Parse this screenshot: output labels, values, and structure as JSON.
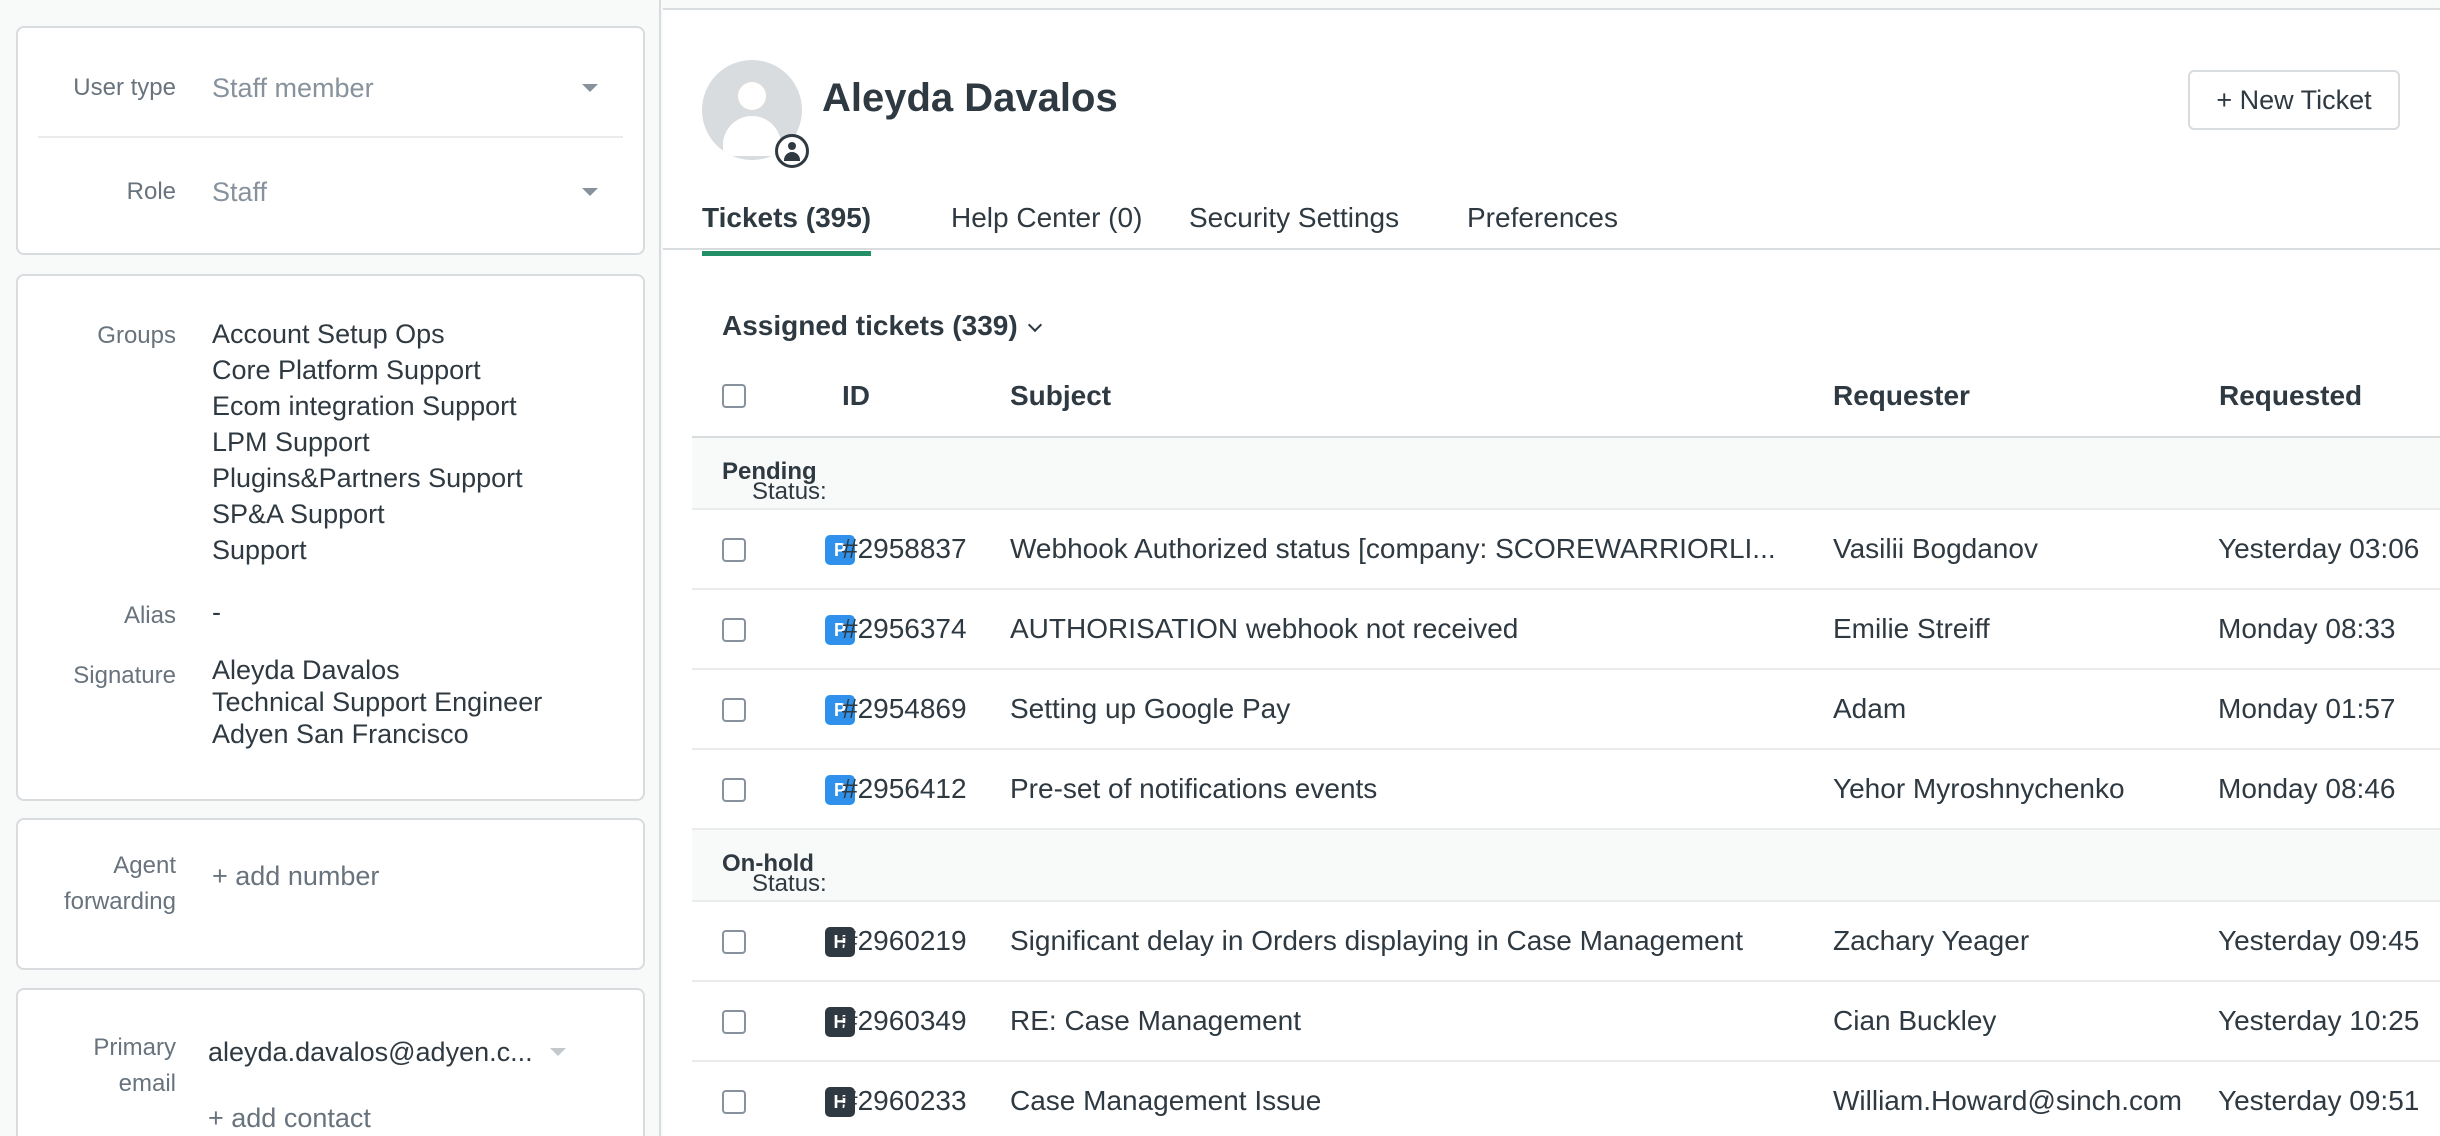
{
  "left": {
    "user_type": {
      "label": "User type",
      "value": "Staff member"
    },
    "role": {
      "label": "Role",
      "value": "Staff"
    },
    "groups": {
      "label": "Groups",
      "items": [
        "Account Setup Ops",
        "Core Platform Support",
        "Ecom integration Support",
        "LPM Support",
        "Plugins&Partners Support",
        "SP&A Support",
        "Support"
      ]
    },
    "alias": {
      "label": "Alias",
      "value": "-"
    },
    "signature": {
      "label": "Signature",
      "lines": [
        "Aleyda Davalos",
        "Technical Support Engineer",
        "Adyen San Francisco"
      ]
    },
    "agent_forwarding": {
      "label_line1": "Agent",
      "label_line2": "forwarding",
      "add_number": "+ add number"
    },
    "primary_email": {
      "label_line1": "Primary",
      "label_line2": "email",
      "value": "aleyda.davalos@adyen.c...",
      "add_contact": "+ add contact"
    }
  },
  "header": {
    "name": "Aleyda Davalos",
    "new_ticket": "+ New Ticket"
  },
  "tabs": [
    {
      "label": "Tickets (395)",
      "active": true
    },
    {
      "label": "Help Center (0)",
      "active": false
    },
    {
      "label": "Security Settings",
      "active": false
    },
    {
      "label": "Preferences",
      "active": false
    }
  ],
  "view_selector": "Assigned tickets (339)",
  "table": {
    "columns": {
      "id": "ID",
      "subject": "Subject",
      "requester": "Requester",
      "requested": "Requested"
    },
    "status_prefix": "Status: ",
    "groups": [
      {
        "status": "Pending",
        "rows": [
          {
            "badge": "P",
            "id": "#2958837",
            "subject": "Webhook Authorized status [company: SCOREWARRIORLI...",
            "requester": "Vasilii Bogdanov",
            "requested": "Yesterday 03:06"
          },
          {
            "badge": "P",
            "id": "#2956374",
            "subject": "AUTHORISATION webhook not received",
            "requester": "Emilie Streiff",
            "requested": "Monday 08:33"
          },
          {
            "badge": "P",
            "id": "#2954869",
            "subject": "Setting up Google Pay",
            "requester": "Adam",
            "requested": "Monday 01:57"
          },
          {
            "badge": "P",
            "id": "#2956412",
            "subject": "Pre-set of notifications events",
            "requester": "Yehor Myroshnychenko",
            "requested": "Monday 08:46"
          }
        ]
      },
      {
        "status": "On-hold",
        "rows": [
          {
            "badge": "H",
            "id": "#2960219",
            "subject": "Significant delay in Orders displaying in Case Management",
            "requester": "Zachary Yeager",
            "requested": "Yesterday 09:45"
          },
          {
            "badge": "H",
            "id": "#2960349",
            "subject": "RE: Case Management",
            "requester": "Cian Buckley",
            "requested": "Yesterday 10:25"
          },
          {
            "badge": "H",
            "id": "#2960233",
            "subject": "Case Management Issue",
            "requester": "William.Howard@sinch.com",
            "requested": "Yesterday 09:51"
          }
        ]
      }
    ]
  },
  "colors": {
    "accent_green": "#228f67",
    "pending_blue": "#3091ec",
    "onhold_dark": "#2f3941"
  }
}
